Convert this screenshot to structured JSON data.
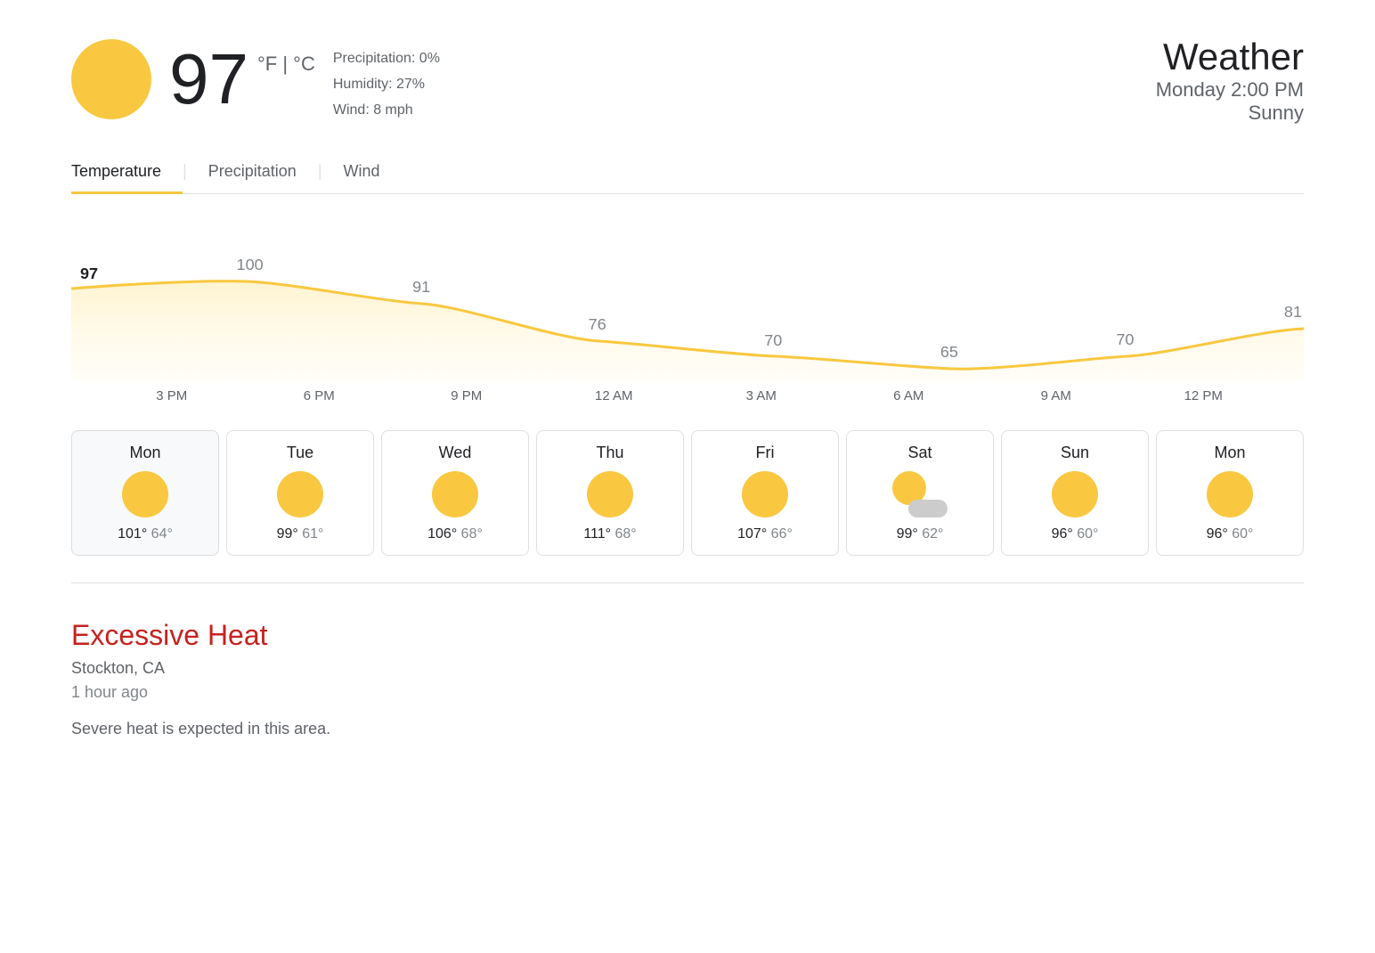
{
  "header": {
    "temperature": "97",
    "unit": "°F | °C",
    "precipitation": "Precipitation: 0%",
    "humidity": "Humidity: 27%",
    "wind": "Wind: 8 mph",
    "weather_label": "Weather",
    "date": "Monday 2:00 PM",
    "condition": "Sunny"
  },
  "tabs": [
    {
      "label": "Temperature",
      "active": true
    },
    {
      "label": "Precipitation",
      "active": false
    },
    {
      "label": "Wind",
      "active": false
    }
  ],
  "chart": {
    "values": [
      97,
      100,
      91,
      76,
      70,
      65,
      70,
      81
    ],
    "labels": [
      "3 PM",
      "6 PM",
      "9 PM",
      "12 AM",
      "3 AM",
      "6 AM",
      "9 AM",
      "12 PM"
    ]
  },
  "days": [
    {
      "name": "Mon",
      "type": "sun",
      "high": "101°",
      "low": "64°",
      "active": true
    },
    {
      "name": "Tue",
      "type": "sun",
      "high": "99°",
      "low": "61°",
      "active": false
    },
    {
      "name": "Wed",
      "type": "sun",
      "high": "106°",
      "low": "68°",
      "active": false
    },
    {
      "name": "Thu",
      "type": "sun",
      "high": "111°",
      "low": "68°",
      "active": false
    },
    {
      "name": "Fri",
      "type": "sun",
      "high": "107°",
      "low": "66°",
      "active": false
    },
    {
      "name": "Sat",
      "type": "partly-cloudy",
      "high": "99°",
      "low": "62°",
      "active": false
    },
    {
      "name": "Sun",
      "type": "sun",
      "high": "96°",
      "low": "60°",
      "active": false
    },
    {
      "name": "Mon",
      "type": "sun",
      "high": "96°",
      "low": "60°",
      "active": false
    }
  ],
  "alert": {
    "title": "Excessive Heat",
    "location": "Stockton, CA",
    "time": "1 hour ago",
    "description": "Severe heat is expected in this area."
  }
}
